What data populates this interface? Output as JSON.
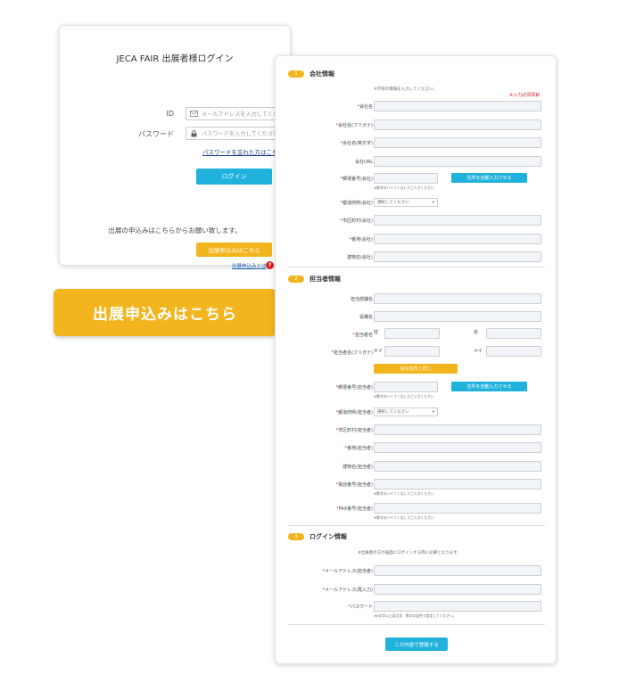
{
  "login": {
    "title": "JECA FAIR 出展者様ログイン",
    "id_label": "ID",
    "id_placeholder": "メールアドレスを入力してください",
    "password_label": "パスワード",
    "password_placeholder": "パスワードを入力してください",
    "forgot_link": "パスワードを忘れた方はこちら>>",
    "login_button": "ログイン",
    "apply_text": "出展の申込みはこちらからお願い致します。",
    "apply_button": "出展申込みはこちら",
    "apply_help_link": "出展申込みとは",
    "help_icon_glyph": "?"
  },
  "banner": {
    "label": "出展申込みはこちら"
  },
  "form": {
    "required_note": "※入力必須項目",
    "sections": [
      {
        "num": "1",
        "title": "会社情報",
        "note": "※学校の情報を入力してください。"
      },
      {
        "num": "2",
        "title": "担当者情報"
      },
      {
        "num": "3",
        "title": "ログイン情報",
        "note": "※出展者の方が画面にログインする際に必要となります。"
      }
    ],
    "company": {
      "name": "会社名",
      "name_kana": "会社名(フリガナ)",
      "name_en": "会社名(英文字)",
      "url": "会社URL",
      "zip": "郵便番号(会社)",
      "zip_hint": "※数字のハイフンなしでご入力ください",
      "auto_address_button": "住所を自動入力させる",
      "prefecture": "都道府県(会社)",
      "prefecture_select": "選択してください",
      "city": "市区町村(会社)",
      "street": "番地(会社)",
      "building": "建物名(会社)"
    },
    "contact": {
      "dept": "担当部課名",
      "position": "役職名",
      "name": "担当者名",
      "sei": "姓",
      "mei": "名",
      "name_kana": "担当者名(フリガナ)",
      "sei_kana": "セイ",
      "mei_kana": "メイ",
      "same_as_company_button": "会社住所と同じ",
      "zip": "郵便番号(担当者)",
      "zip_hint": "※数字のハイフンなしでご入力ください",
      "auto_address_button": "住所を自動入力させる",
      "prefecture": "都道府県(担当者)",
      "prefecture_select": "選択してください",
      "city": "市区町村(担当者)",
      "street": "番地(担当者)",
      "building": "建物名(担当者)",
      "phone": "電話番号(担当者)",
      "phone_hint": "※数字のハイフンなしでご入力ください",
      "fax": "FAX番号(担当者)",
      "fax_hint": "※数字のハイフンなしでご入力ください"
    },
    "login_info": {
      "email": "メールアドレス(担当者)",
      "email_confirm": "メールアドレス(再入力)",
      "password": "パスワード",
      "password_hint": "※8文字以上英文字、数字の混合で設定してください。"
    },
    "register_button": "この内容で登録する",
    "required_mark": "*"
  },
  "colors": {
    "accent_blue": "#20b2dc",
    "accent_yellow": "#f2b51e",
    "required_red": "#d81f26"
  }
}
